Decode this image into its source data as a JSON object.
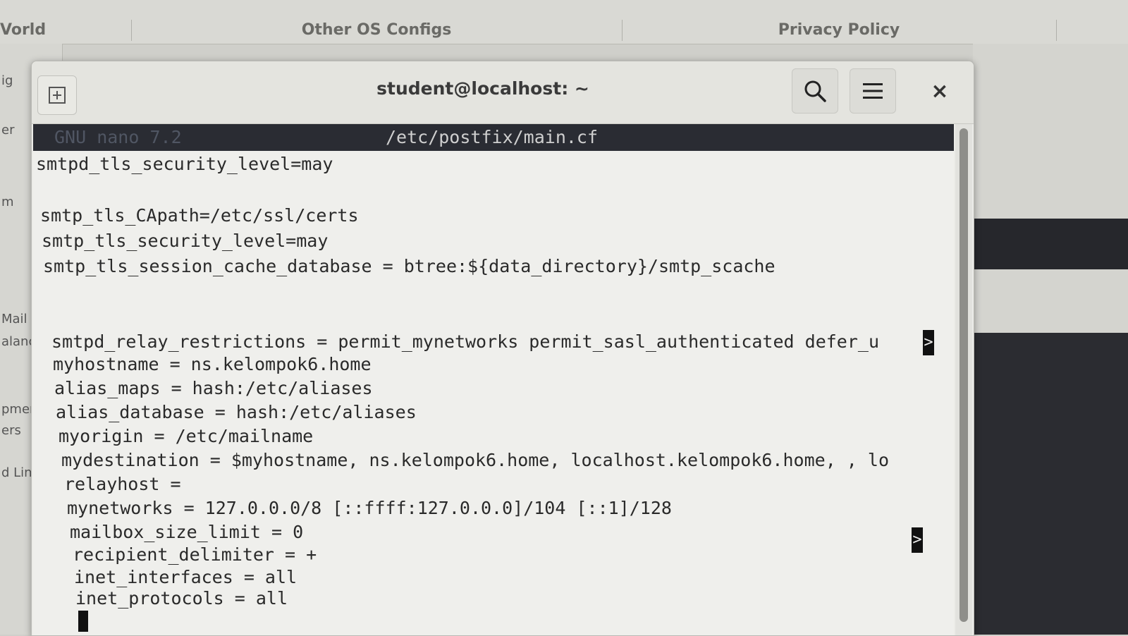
{
  "background": {
    "tabs": [
      {
        "label": "Vorld"
      },
      {
        "label": "Other OS Configs"
      },
      {
        "label": "Privacy Policy"
      }
    ],
    "sidebar_items": [
      "ig",
      "er",
      "m",
      "Mail",
      "alance",
      "pment",
      "ers",
      "d Link"
    ]
  },
  "window": {
    "title": "student@localhost: ~",
    "icons": {
      "new_tab": "new-tab-icon",
      "search": "search-icon",
      "menu": "hamburger-menu-icon",
      "close": "close-icon"
    },
    "close_glyph": "×"
  },
  "editor": {
    "version_label": "GNU nano 7.2",
    "filename": "/etc/postfix/main.cf",
    "overflow_marker": ">",
    "lines": [
      "smtpd_tls_security_level=may",
      "",
      "smtp_tls_CApath=/etc/ssl/certs",
      "smtp_tls_security_level=may",
      "smtp_tls_session_cache_database = btree:${data_directory}/smtp_scache",
      "",
      "",
      "smtpd_relay_restrictions = permit_mynetworks permit_sasl_authenticated defer_u",
      "myhostname = ns.kelompok6.home",
      "alias_maps = hash:/etc/aliases",
      "alias_database = hash:/etc/aliases",
      "myorigin = /etc/mailname",
      "mydestination = $myhostname, ns.kelompok6.home, localhost.kelompok6.home, , lo",
      "relayhost =",
      "mynetworks = 127.0.0.0/8 [::ffff:127.0.0.0]/104 [::1]/128",
      "mailbox_size_limit = 0",
      "recipient_delimiter = +",
      "inet_interfaces = all",
      "inet_protocols = all"
    ]
  }
}
